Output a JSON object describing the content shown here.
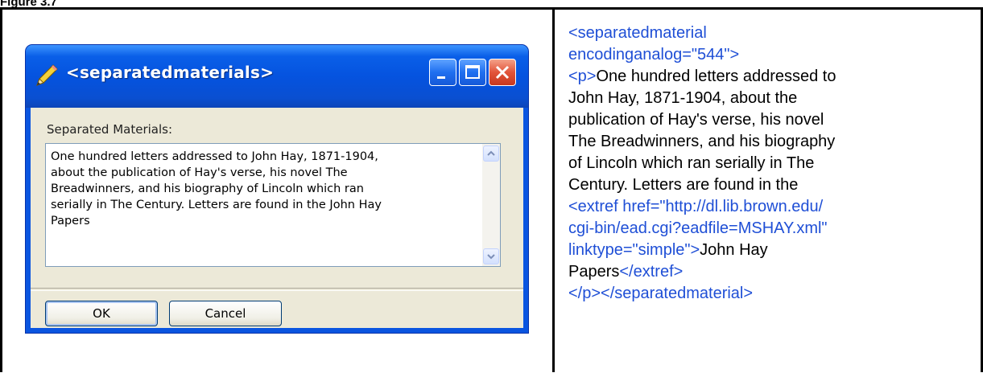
{
  "figure_label": "Figure 3.7",
  "dialog": {
    "title": "<separatedmaterials>",
    "field_label": "Separated Materials:",
    "field_value": "One hundred letters addressed to John Hay, 1871-1904,\nabout the publication of Hay's verse, his novel The\nBreadwinners, and his biography of Lincoln which ran\nserially in The Century. Letters are found in the John Hay\nPapers",
    "ok_label": "OK",
    "cancel_label": "Cancel"
  },
  "xml": {
    "l1": "<separatedmaterial",
    "l2": "encodinganalog=\"544\">",
    "l3_tag": "<p>",
    "l3_text": "One hundred letters addressed to",
    "l4": "John Hay, 1871-1904, about the",
    "l5": "publication of Hay's verse, his novel",
    "l6": "The Breadwinners, and his biography",
    "l7": "of Lincoln which ran serially in The",
    "l8": "Century. Letters are found in the",
    "l9": "<extref href=\"http://dl.lib.brown.edu/",
    "l10": "cgi-bin/ead.cgi?eadfile=MSHAY.xml\"",
    "l11_tag": "linktype=\"simple\">",
    "l11_text": "John Hay",
    "l12_text": "Papers",
    "l12_tag": "</extref>",
    "l13": "</p></separatedmaterial>"
  },
  "colors": {
    "xml_tag": "#1f4fd6",
    "titlebar": "#0553df"
  },
  "icons": [
    "pencil-icon",
    "minimize-icon",
    "maximize-icon",
    "close-icon",
    "scroll-up-arrow-icon",
    "scroll-down-arrow-icon"
  ]
}
